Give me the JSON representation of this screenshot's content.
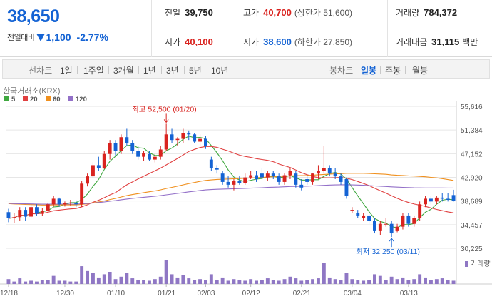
{
  "quote": {
    "price": "38,650",
    "change_label": "전일대비",
    "change_amount": "1,100",
    "change_percent": "-2.77%",
    "prev_close": {
      "label": "전일",
      "value": "39,750"
    },
    "open": {
      "label": "시가",
      "value": "40,100"
    },
    "high": {
      "label": "고가",
      "value": "40,700",
      "sub": "(상한가 51,600)"
    },
    "low": {
      "label": "저가",
      "value": "38,600",
      "sub": "(하한가 27,850)"
    },
    "volume": {
      "label": "거래량",
      "value": "784,372"
    },
    "amount": {
      "label": "거래대금",
      "value": "31,115",
      "unit": "백만"
    },
    "colors": {
      "up": "#d9231f",
      "down": "#1463d4"
    }
  },
  "toolbar": {
    "line_chart_label": "선차트",
    "periods": [
      "1일",
      "1주일",
      "3개월",
      "1년",
      "3년",
      "5년",
      "10년"
    ],
    "candle_chart_label": "봉차트",
    "candle_periods": [
      "일봉",
      "주봉",
      "월봉"
    ],
    "active_candle_period": "일봉"
  },
  "chart_data": {
    "type": "candlestick",
    "exchange_label": "한국거래소(KRX)",
    "legend": [
      {
        "name": "5",
        "color": "#3fa83f"
      },
      {
        "name": "20",
        "color": "#e04040"
      },
      {
        "name": "60",
        "color": "#f0901e"
      },
      {
        "name": "120",
        "color": "#9370c8"
      }
    ],
    "y_ticks": [
      "55,616",
      "51,384",
      "47,152",
      "42,920",
      "38,689",
      "34,457",
      "30,225"
    ],
    "ylim": [
      30225,
      55616
    ],
    "x_ticks": [
      "12/18",
      "12/30",
      "01/10",
      "01/21",
      "02/03",
      "02/12",
      "02/21",
      "03/04",
      "03/13"
    ],
    "volume_label": "거래량",
    "annotations": {
      "high": "최고 52,500 (01/20)",
      "low": "최저 32,250 (03/11)"
    },
    "candles": [
      [
        36700,
        37300,
        34900,
        35600
      ],
      [
        35600,
        36600,
        34700,
        35800
      ],
      [
        35800,
        37600,
        35200,
        37100
      ],
      [
        37100,
        37600,
        35200,
        35900
      ],
      [
        35900,
        38100,
        35600,
        37600
      ],
      [
        37600,
        38100,
        36100,
        36400
      ],
      [
        36400,
        37400,
        36000,
        36900
      ],
      [
        36900,
        38400,
        36800,
        38100
      ],
      [
        38100,
        39600,
        37700,
        39100
      ],
      [
        39100,
        39300,
        37700,
        38100
      ],
      [
        38100,
        38600,
        37700,
        38300
      ],
      [
        38300,
        38900,
        37900,
        38400
      ],
      [
        38400,
        38800,
        37600,
        38100
      ],
      [
        38100,
        42300,
        37600,
        41800
      ],
      [
        41800,
        43600,
        41300,
        43100
      ],
      [
        43100,
        45600,
        42900,
        45100
      ],
      [
        45100,
        46600,
        44100,
        44600
      ],
      [
        44600,
        47600,
        44400,
        47100
      ],
      [
        47100,
        49600,
        46100,
        49100
      ],
      [
        49100,
        49600,
        46700,
        47600
      ],
      [
        47600,
        50600,
        47100,
        50100
      ],
      [
        50100,
        51600,
        48600,
        49100
      ],
      [
        49100,
        49600,
        47100,
        47600
      ],
      [
        47600,
        48600,
        46100,
        46600
      ],
      [
        46600,
        47600,
        45900,
        47200
      ],
      [
        47100,
        47600,
        45900,
        46100
      ],
      [
        46100,
        47100,
        45600,
        46600
      ],
      [
        46600,
        48600,
        46100,
        47900
      ],
      [
        47900,
        52500,
        47600,
        50600
      ],
      [
        50600,
        51600,
        49100,
        49600
      ],
      [
        49600,
        50100,
        48600,
        49800
      ],
      [
        49800,
        51600,
        49100,
        50800
      ],
      [
        50800,
        51300,
        49600,
        50600
      ],
      [
        50600,
        50800,
        49100,
        49300
      ],
      [
        49300,
        50600,
        48600,
        49800
      ],
      [
        49800,
        50300,
        48000,
        48600
      ],
      [
        46100,
        46600,
        44100,
        44600
      ],
      [
        44600,
        45100,
        43600,
        44300
      ],
      [
        43600,
        44100,
        41600,
        42100
      ],
      [
        42100,
        43100,
        41100,
        41600
      ],
      [
        41600,
        42600,
        40600,
        42300
      ],
      [
        42300,
        43100,
        41600,
        41900
      ],
      [
        41900,
        43600,
        41600,
        42900
      ],
      [
        42900,
        44100,
        42600,
        43300
      ],
      [
        43300,
        44100,
        42100,
        42600
      ],
      [
        43600,
        44600,
        42600,
        42900
      ],
      [
        42900,
        44100,
        42300,
        43600
      ],
      [
        43600,
        44100,
        42600,
        43100
      ],
      [
        43100,
        43600,
        41600,
        42100
      ],
      [
        42100,
        43600,
        41600,
        43300
      ],
      [
        43300,
        44600,
        42600,
        44100
      ],
      [
        43600,
        44100,
        41100,
        41600
      ],
      [
        41600,
        42600,
        40600,
        41100
      ],
      [
        42600,
        43100,
        41600,
        42100
      ],
      [
        42100,
        43600,
        41600,
        43600
      ],
      [
        43600,
        45100,
        42600,
        44100
      ],
      [
        44100,
        48600,
        43600,
        44600
      ],
      [
        44600,
        45100,
        43100,
        43600
      ],
      [
        43600,
        44600,
        42600,
        43100
      ],
      [
        43100,
        43600,
        41600,
        42100
      ],
      [
        42600,
        42900,
        39100,
        39600
      ],
      [
        37100,
        37600,
        36600,
        37100
      ],
      [
        36600,
        37100,
        35600,
        36100
      ],
      [
        35600,
        36600,
        35100,
        36100
      ],
      [
        36100,
        36600,
        34600,
        35100
      ],
      [
        35100,
        35600,
        32900,
        33300
      ],
      [
        33300,
        35100,
        32600,
        34600
      ],
      [
        34600,
        35600,
        34100,
        34600
      ],
      [
        34600,
        35100,
        32250,
        32900
      ],
      [
        33300,
        34600,
        33100,
        34100
      ],
      [
        34100,
        36600,
        33600,
        36100
      ],
      [
        36100,
        36600,
        34100,
        34600
      ],
      [
        34600,
        36100,
        34100,
        35600
      ],
      [
        35600,
        38600,
        35100,
        38100
      ],
      [
        38100,
        39600,
        37600,
        39100
      ],
      [
        39100,
        39600,
        38100,
        38600
      ],
      [
        38600,
        39600,
        38100,
        39300
      ],
      [
        39300,
        40100,
        38600,
        39100
      ],
      [
        39100,
        40100,
        38600,
        38900
      ],
      [
        39750,
        40700,
        38600,
        38650
      ]
    ],
    "volumes": [
      6,
      3,
      7,
      3,
      4,
      3,
      5,
      5,
      10,
      4,
      4,
      3,
      3,
      22,
      16,
      14,
      8,
      12,
      15,
      6,
      9,
      14,
      7,
      5,
      5,
      4,
      6,
      9,
      30,
      12,
      8,
      11,
      7,
      5,
      6,
      5,
      12,
      5,
      8,
      4,
      6,
      5,
      4,
      6,
      4,
      5,
      7,
      5,
      4,
      6,
      9,
      7,
      4,
      5,
      6,
      7,
      26,
      8,
      6,
      5,
      14,
      6,
      5,
      4,
      5,
      12,
      10,
      5,
      9,
      6,
      8,
      5,
      6,
      12,
      8,
      5,
      6,
      7,
      5,
      4
    ]
  }
}
